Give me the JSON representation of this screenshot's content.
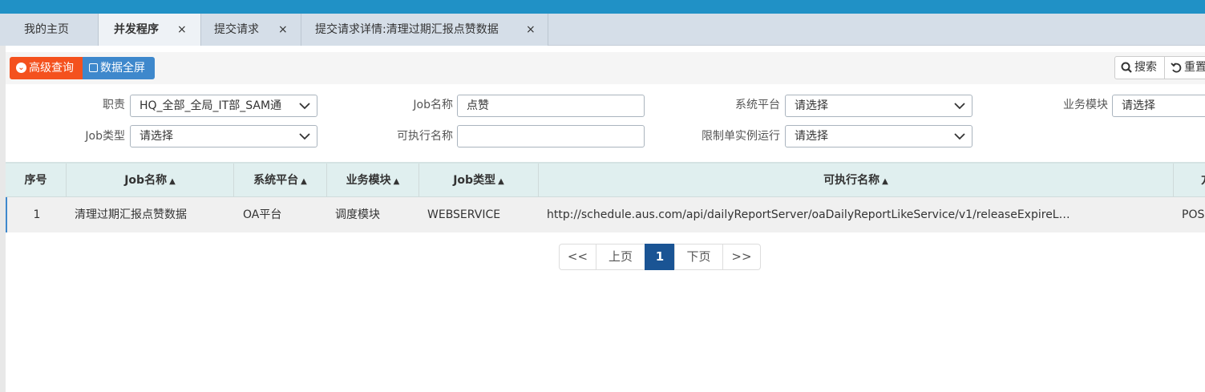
{
  "tabs": [
    {
      "label": "我的主页",
      "closable": false
    },
    {
      "label": "并发程序",
      "closable": true,
      "active": true
    },
    {
      "label": "提交请求",
      "closable": true
    },
    {
      "label": "提交请求详情:清理过期汇报点赞数据",
      "closable": true
    }
  ],
  "tab_close_glyph": "×",
  "toolbar": {
    "advanced_query": "高级查询",
    "fullscreen": "数据全屏",
    "search": "搜索",
    "reset": "重置"
  },
  "filters": {
    "duty_label": "职责",
    "duty_value": "HQ_全部_全局_IT部_SAM通",
    "job_name_label": "Job名称",
    "job_name_value": "点赞",
    "platform_label": "系统平台",
    "platform_value": "请选择",
    "module_label": "业务模块",
    "module_value": "请选择",
    "job_type_label": "Job类型",
    "job_type_value": "请选择",
    "exec_name_label": "可执行名称",
    "exec_name_value": "",
    "single_instance_label": "限制单实例运行",
    "single_instance_value": "请选择"
  },
  "table": {
    "columns": [
      "序号",
      "Job名称",
      "系统平台",
      "业务模块",
      "Job类型",
      "可执行名称",
      "方"
    ],
    "rows": [
      [
        "1",
        "清理过期汇报点赞数据",
        "OA平台",
        "调度模块",
        "WEBSERVICE",
        "http://schedule.aus.com/api/dailyReportServer/oaDailyReportLikeService/v1/releaseExpireL…",
        "POS"
      ]
    ]
  },
  "pagination": {
    "first": "<<",
    "prev": "上页",
    "current": "1",
    "next": "下页",
    "last": ">>"
  },
  "colors": {
    "topbar": "#2091c6",
    "advanced_button": "#f4511e",
    "fullscreen_button": "#3e88cc",
    "table_header": "#e0efef",
    "active_page": "#1a5494"
  }
}
